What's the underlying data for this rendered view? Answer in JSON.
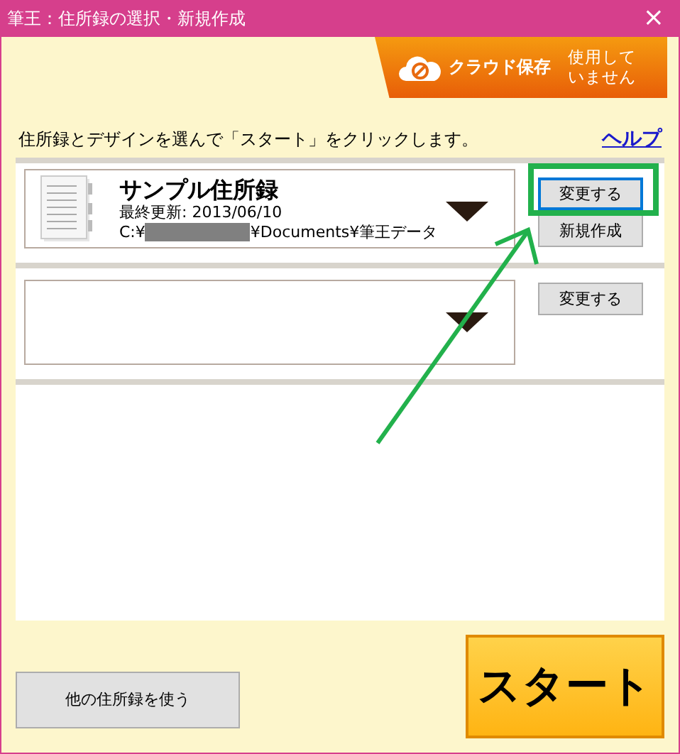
{
  "window": {
    "title": "筆王：住所録の選択・新規作成",
    "close": "×"
  },
  "cloud": {
    "label": "クラウド保存",
    "status": [
      "使用して",
      "いません"
    ]
  },
  "instruction": "住所録とデザインを選んで「スタート」をクリックします。",
  "help_link": "ヘルプ",
  "slots": [
    {
      "kind": "book",
      "name": "サンプル住所録",
      "updated": "最終更新: 2013/06/10",
      "path_prefix": "C:¥",
      "path_suffix": "¥Documents¥筆王データ",
      "buttons": [
        {
          "label": "変更する",
          "focused": true
        },
        {
          "label": "新規作成",
          "focused": false
        }
      ]
    },
    {
      "kind": "empty",
      "buttons": [
        {
          "label": "変更する",
          "focused": false
        }
      ]
    }
  ],
  "other_button": "他の住所録を使う",
  "start_button": "スタート",
  "annotation": {
    "highlight": true
  }
}
